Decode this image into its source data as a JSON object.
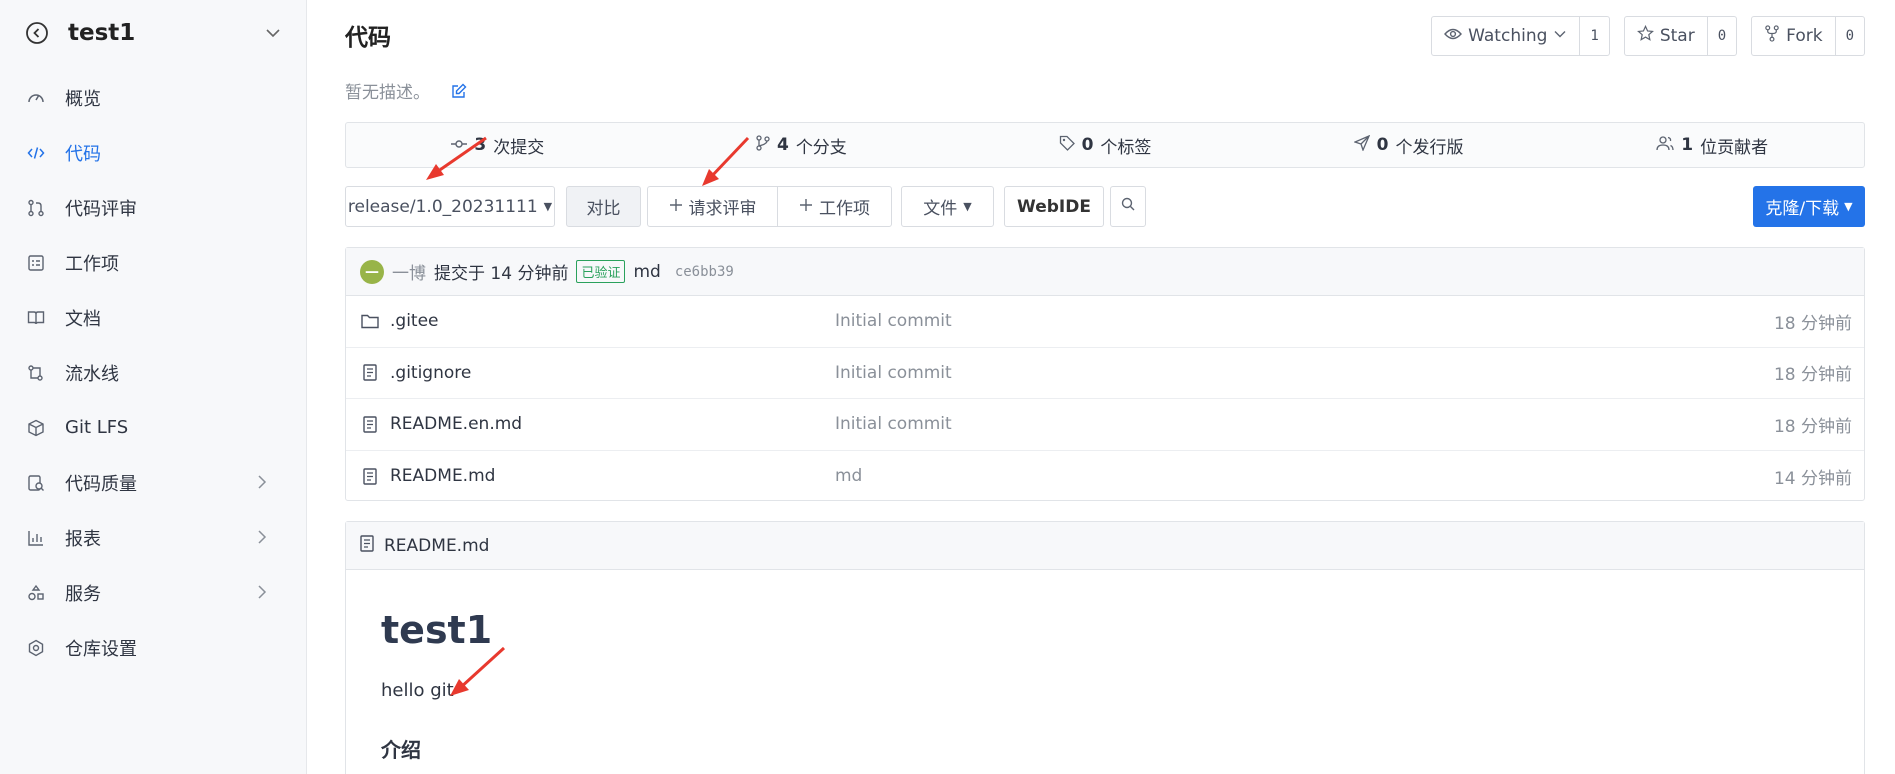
{
  "sidebar": {
    "repo_name": "test1",
    "items": [
      {
        "label": "概览"
      },
      {
        "label": "代码"
      },
      {
        "label": "代码评审"
      },
      {
        "label": "工作项"
      },
      {
        "label": "文档"
      },
      {
        "label": "流水线"
      },
      {
        "label": "Git LFS"
      },
      {
        "label": "代码质量"
      },
      {
        "label": "报表"
      },
      {
        "label": "服务"
      },
      {
        "label": "仓库设置"
      }
    ]
  },
  "header": {
    "title": "代码",
    "description": "暂无描述。",
    "watch_label": "Watching",
    "watch_count": "1",
    "star_label": "Star",
    "star_count": "0",
    "fork_label": "Fork",
    "fork_count": "0"
  },
  "stats": {
    "commits_num": "3",
    "commits_label": "次提交",
    "branches_num": "4",
    "branches_label": "个分支",
    "tags_num": "0",
    "tags_label": "个标签",
    "releases_num": "0",
    "releases_label": "个发行版",
    "contributors_num": "1",
    "contributors_label": "位贡献者"
  },
  "toolbar": {
    "branch": "release/1.0_20231111",
    "compare": "对比",
    "pull_request": "请求评审",
    "work_item": "工作项",
    "file": "文件",
    "webide": "WebIDE",
    "clone": "克隆/下载"
  },
  "commit": {
    "author": "一博",
    "action": "提交于 14 分钟前",
    "verified": "已验证",
    "message": "md",
    "sha": "ce6bb39"
  },
  "files": [
    {
      "name": ".gitee",
      "message": "Initial commit",
      "time": "18 分钟前"
    },
    {
      "name": ".gitignore",
      "message": "Initial commit",
      "time": "18 分钟前"
    },
    {
      "name": "README.en.md",
      "message": "Initial commit",
      "time": "18 分钟前"
    },
    {
      "name": "README.md",
      "message": "md",
      "time": "14 分钟前"
    }
  ],
  "readme": {
    "filename": "README.md",
    "h1": "test1",
    "paragraph": "hello git",
    "h2": "介绍"
  },
  "colors": {
    "accent": "#2473e8",
    "annotation": "#e8392e",
    "verified": "#2aa15c"
  }
}
